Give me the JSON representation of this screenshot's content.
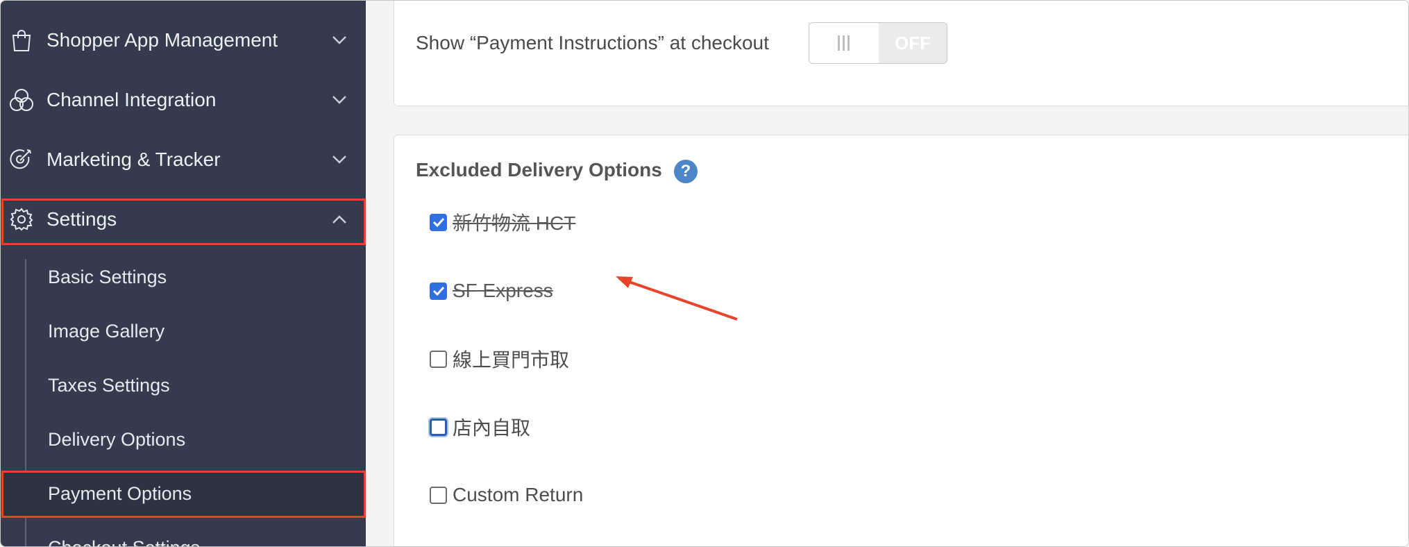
{
  "sidebar": {
    "items": [
      {
        "label": "Shopper App Management",
        "icon": "shopping-bag-icon",
        "chevron": "chevron-down-icon"
      },
      {
        "label": "Channel Integration",
        "icon": "channels-icon",
        "chevron": "chevron-down-icon"
      },
      {
        "label": "Marketing & Tracker",
        "icon": "target-icon",
        "chevron": "chevron-down-icon"
      },
      {
        "label": "Settings",
        "icon": "gear-icon",
        "chevron": "chevron-up-icon"
      }
    ],
    "submenu": [
      {
        "label": "Basic Settings"
      },
      {
        "label": "Image Gallery"
      },
      {
        "label": "Taxes Settings"
      },
      {
        "label": "Delivery Options"
      },
      {
        "label": "Payment Options"
      },
      {
        "label": "Checkout Settings"
      }
    ]
  },
  "payment_instructions": {
    "label": "Show “Payment Instructions” at checkout",
    "toggle_state": "OFF"
  },
  "excluded_delivery": {
    "title": "Excluded Delivery Options",
    "help": "?",
    "options": [
      {
        "label": "新竹物流 HCT",
        "checked": true
      },
      {
        "label": "SF Express",
        "checked": true
      },
      {
        "label": "線上買門市取",
        "checked": false
      },
      {
        "label": "店內自取",
        "checked": false
      },
      {
        "label": "Custom Return",
        "checked": false
      }
    ]
  },
  "colors": {
    "sidebar_bg": "#333b4d",
    "highlight": "#e8442b",
    "checkbox_checked": "#2f6fe0",
    "help_icon": "#4c86c6"
  }
}
